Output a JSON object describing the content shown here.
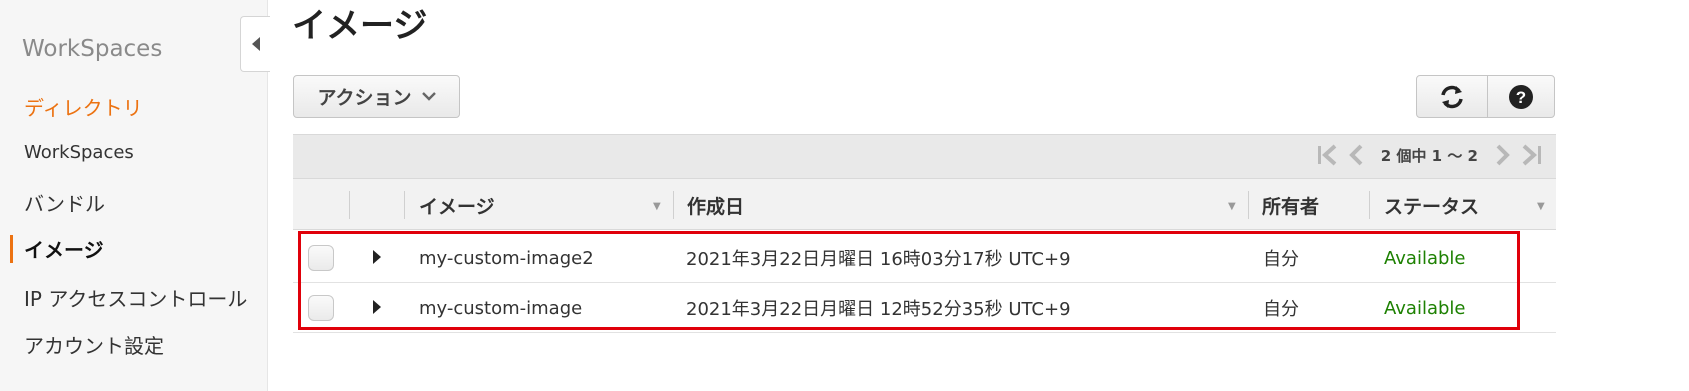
{
  "sidebar": {
    "title": "WorkSpaces",
    "items": [
      {
        "label": "ディレクトリ"
      },
      {
        "label": "WorkSpaces"
      },
      {
        "label": "バンドル"
      },
      {
        "label": "イメージ"
      },
      {
        "label": "IP アクセスコントロール"
      },
      {
        "label": "アカウント設定"
      }
    ],
    "active_item": "イメージ"
  },
  "page": {
    "title": "イメージ"
  },
  "toolbar": {
    "actions_label": "アクション",
    "refresh_icon": "refresh-icon",
    "help_icon": "help-icon"
  },
  "pagination": {
    "text": "2 個中 1 〜 2"
  },
  "table": {
    "columns": [
      "イメージ",
      "作成日",
      "所有者",
      "ステータス"
    ],
    "rows": [
      {
        "name": "my-custom-image2",
        "created": "2021年3月22日月曜日 16時03分17秒 UTC+9",
        "owner": "自分",
        "status": "Available"
      },
      {
        "name": "my-custom-image",
        "created": "2021年3月22日月曜日 12時52分35秒 UTC+9",
        "owner": "自分",
        "status": "Available"
      }
    ]
  },
  "colors": {
    "accent": "#ec7211",
    "status_available": "#1d8102",
    "highlight_border": "#e0000a"
  }
}
